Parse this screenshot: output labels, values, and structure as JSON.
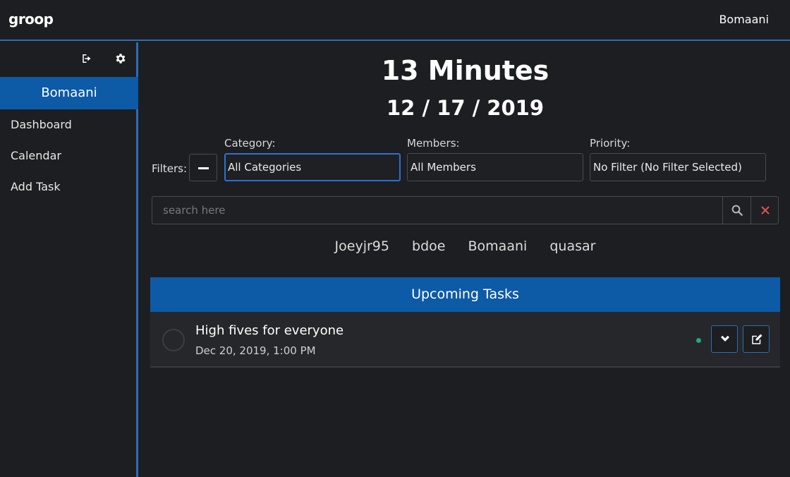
{
  "app": {
    "brand": "groop",
    "user": "Bomaani"
  },
  "sidebar": {
    "user": "Bomaani",
    "items": [
      {
        "label": "Dashboard"
      },
      {
        "label": "Calendar"
      },
      {
        "label": "Add Task"
      }
    ],
    "icons": [
      "sign-out-icon",
      "gear-icon"
    ]
  },
  "main": {
    "time_until": "13 Minutes",
    "date": "12 / 17 / 2019",
    "filters": {
      "label": "Filters:",
      "category": {
        "label": "Category:",
        "value": "All Categories"
      },
      "members": {
        "label": "Members:",
        "value": "All Members"
      },
      "priority": {
        "label": "Priority:",
        "value": "No Filter (No Filter Selected)"
      }
    },
    "search": {
      "placeholder": "search here"
    },
    "members_list": [
      "Joeyjr95",
      "bdoe",
      "Bomaani",
      "quasar"
    ],
    "upcoming_header": "Upcoming Tasks",
    "tasks": [
      {
        "title": "High fives for everyone",
        "date": "Dec 20, 2019, 1:00 PM",
        "priority_color": "#22a67a"
      }
    ]
  },
  "colors": {
    "accent": "#0d5aa7",
    "border": "#2e6cb5",
    "background": "#1d1e21",
    "clear": "#d9534f"
  }
}
